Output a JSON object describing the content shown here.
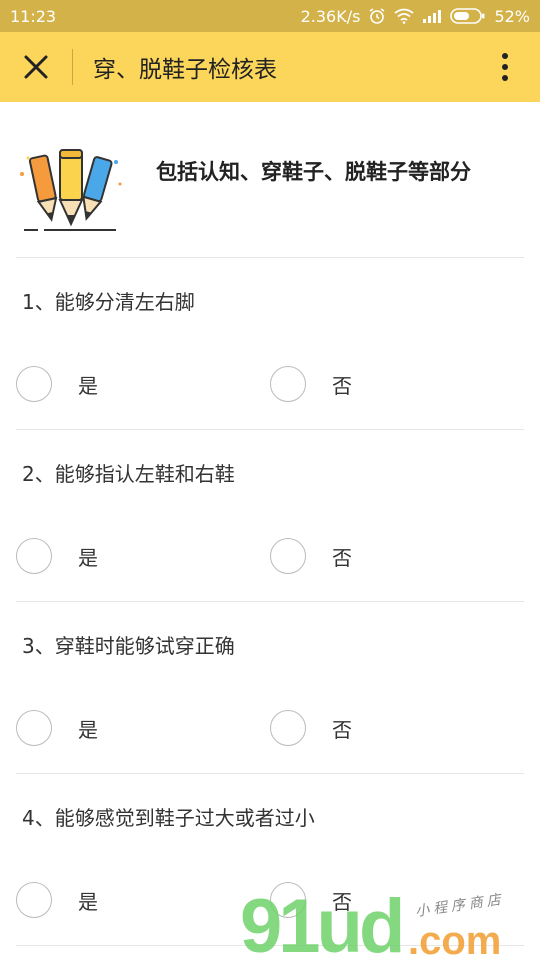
{
  "status": {
    "time": "11:23",
    "speed": "2.36K/s",
    "battery": "52%"
  },
  "nav": {
    "title": "穿、脱鞋子检核表"
  },
  "intro": {
    "text": "包括认知、穿鞋子、脱鞋子等部分"
  },
  "questions": [
    {
      "title": "1、能够分清左右脚",
      "yes": "是",
      "no": "否"
    },
    {
      "title": "2、能够指认左鞋和右鞋",
      "yes": "是",
      "no": "否"
    },
    {
      "title": "3、穿鞋时能够试穿正确",
      "yes": "是",
      "no": "否"
    },
    {
      "title": "4、能够感觉到鞋子过大或者过小",
      "yes": "是",
      "no": "否"
    }
  ],
  "watermark": {
    "brand": "91ud",
    "domain": ".com",
    "tagline": "小程序商店"
  },
  "colors": {
    "status_bar": "#d4b24a",
    "nav_bar": "#fbd65a",
    "watermark_green": "#6fd36a",
    "watermark_orange": "#f2a33a"
  },
  "icons": [
    "close-icon",
    "more-icon",
    "pencils-icon",
    "alarm-icon",
    "wifi-icon",
    "signal-icon",
    "battery-icon"
  ]
}
